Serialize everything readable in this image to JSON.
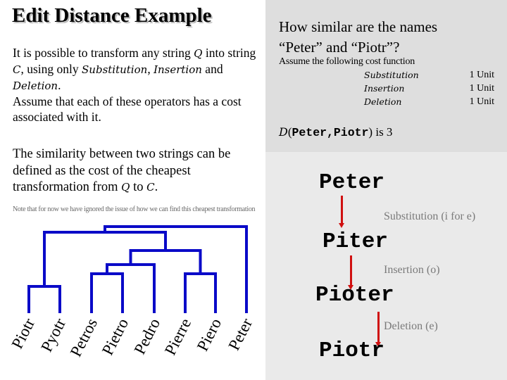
{
  "slide": {
    "title": "Edit Distance Example",
    "intro": {
      "line1_pre": "It is possible to transform any string ",
      "q": "Q",
      "line1_post": " into string ",
      "c": "C",
      "line2_mid": ", using only ",
      "substitution": "Substitution",
      "comma": ", ",
      "insertion": "Insertion",
      "and": " and ",
      "deletion": "Deletion",
      "period": ".",
      "assume": "Assume that each of these operators has a cost associated with it."
    },
    "similarity": {
      "text": "The similarity between two strings can be defined as the cost of the cheapest transformation from ",
      "q": "Q",
      "to": " to ",
      "c": "C",
      "end": "."
    },
    "note": "Note that for now we have ignored the issue of how we can find this cheapest transformation"
  },
  "cost_panel": {
    "question_line1": "How similar are the names",
    "question_line2": "“Peter” and “Piotr”?",
    "assume": "Assume the following cost function",
    "costs": [
      {
        "operation": "Substitution",
        "value": "1 Unit"
      },
      {
        "operation": "Insertion",
        "value": "1 Unit"
      },
      {
        "operation": "Deletion",
        "value": "1 Unit"
      }
    ],
    "distance": {
      "fn": "D",
      "open": "(",
      "args": "Peter,Piotr",
      "close": ")",
      "result": " is 3"
    }
  },
  "transformation": {
    "steps": [
      {
        "word": "Peter"
      },
      {
        "word": "Piter",
        "operation": "Substitution (i for e)"
      },
      {
        "word": "Pioter",
        "operation": "Insertion  (o)"
      },
      {
        "word": "Piotr",
        "operation": "Deletion  (e)"
      }
    ],
    "arrow_color": "#d01010"
  },
  "dendrogram": {
    "line_color": "#0a0ac8",
    "leaves": [
      "Piotr",
      "Pyotr",
      "Petros",
      "Pietro",
      "Pedro",
      "Pierre",
      "Piero",
      "Peter"
    ]
  }
}
